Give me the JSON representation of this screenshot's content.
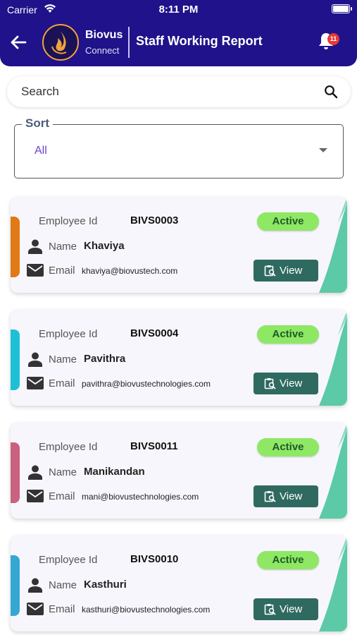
{
  "status_bar": {
    "carrier": "Carrier",
    "time": "8:11 PM"
  },
  "header": {
    "brand_name": "Biovus",
    "brand_sub": "Connect",
    "title": "Staff Working Report",
    "notification_count": "11"
  },
  "search": {
    "placeholder": "Search"
  },
  "sort": {
    "label": "Sort",
    "value": "All"
  },
  "labels": {
    "employee_id": "Employee Id",
    "name": "Name",
    "email": "Email",
    "view": "View"
  },
  "employees": [
    {
      "id": "BIVS0003",
      "name": "Khaviya",
      "email": "khaviya@biovustech.com",
      "status": "Active",
      "color": "#e07a16"
    },
    {
      "id": "BIVS0004",
      "name": "Pavithra",
      "email": "pavithra@biovustechnologies.com",
      "status": "Active",
      "color": "#1ec0d6"
    },
    {
      "id": "BIVS0011",
      "name": "Manikandan",
      "email": "mani@biovustechnologies.com",
      "status": "Active",
      "color": "#c9627e"
    },
    {
      "id": "BIVS0010",
      "name": "Kasthuri",
      "email": "kasthuri@biovustechnologies.com",
      "status": "Active",
      "color": "#36a7d3"
    }
  ],
  "colors": {
    "primary": "#20128a",
    "active_badge": "#8ee864",
    "view_button": "#2f6a60",
    "wave": "#5cc9a7"
  }
}
